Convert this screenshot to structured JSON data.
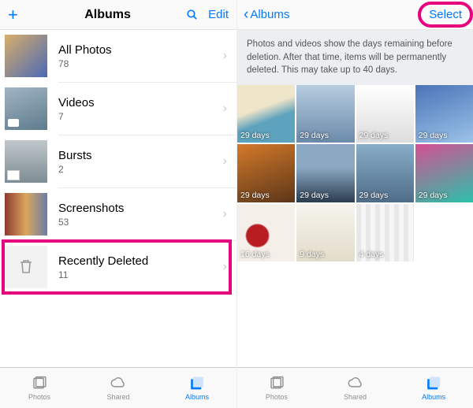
{
  "left": {
    "header": {
      "title": "Albums",
      "edit": "Edit"
    },
    "albums": [
      {
        "name": "All Photos",
        "count": "78"
      },
      {
        "name": "Videos",
        "count": "7"
      },
      {
        "name": "Bursts",
        "count": "2"
      },
      {
        "name": "Screenshots",
        "count": "53"
      },
      {
        "name": "Recently Deleted",
        "count": "11"
      }
    ]
  },
  "right": {
    "back": "Albums",
    "select": "Select",
    "info": "Photos and videos show the days remaining before deletion. After that time, items will be permanently deleted. This may take up to 40 days.",
    "cells": [
      {
        "days": "29 days"
      },
      {
        "days": "29 days"
      },
      {
        "days": "29 days"
      },
      {
        "days": "29 days"
      },
      {
        "days": "29 days"
      },
      {
        "days": "29 days"
      },
      {
        "days": "29 days"
      },
      {
        "days": "29 days"
      },
      {
        "days": "16 days"
      },
      {
        "days": "9 days"
      },
      {
        "days": "4 days"
      }
    ]
  },
  "tabbar": {
    "photos": "Photos",
    "shared": "Shared",
    "albums": "Albums"
  }
}
